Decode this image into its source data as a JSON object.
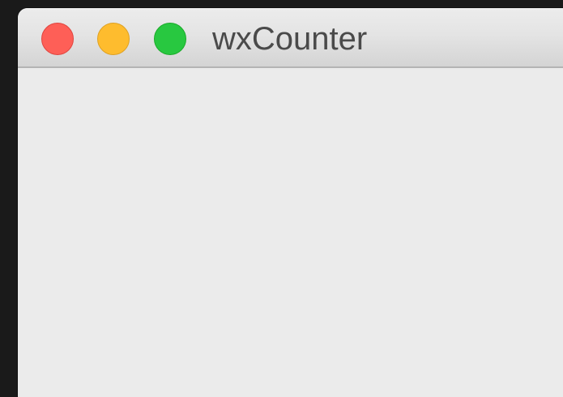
{
  "window": {
    "title": "wxCounter",
    "controls": {
      "close": {
        "icon": "close-traffic-light-icon",
        "color": "#fe5f57"
      },
      "minimize": {
        "icon": "minimize-traffic-light-icon",
        "color": "#febc2e"
      },
      "zoom": {
        "icon": "zoom-traffic-light-icon",
        "color": "#28c840"
      }
    }
  }
}
